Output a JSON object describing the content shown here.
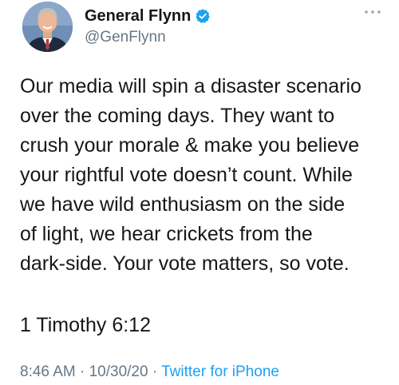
{
  "tweet": {
    "author": {
      "display_name": "General Flynn",
      "handle": "@GenFlynn",
      "verified_icon": "verified-badge-icon",
      "avatar_icon": "profile-avatar"
    },
    "more_icon": "more-options-icon",
    "body_lines": [
      "Our media will spin a disaster scenario",
      "over the coming days. They want to",
      "crush your morale & make you believe",
      "your rightful vote doesn’t count. While",
      "we have wild enthusiasm on the side",
      "of light, we hear crickets from the",
      "dark-side. Your vote matters, so vote."
    ],
    "verse": "1 Timothy 6:12",
    "meta": {
      "time": "8:46 AM",
      "separator": " · ",
      "date": "10/30/20",
      "source": "Twitter for iPhone"
    }
  },
  "colors": {
    "text": "#14171a",
    "secondary": "#657786",
    "accent": "#1da1f2"
  }
}
